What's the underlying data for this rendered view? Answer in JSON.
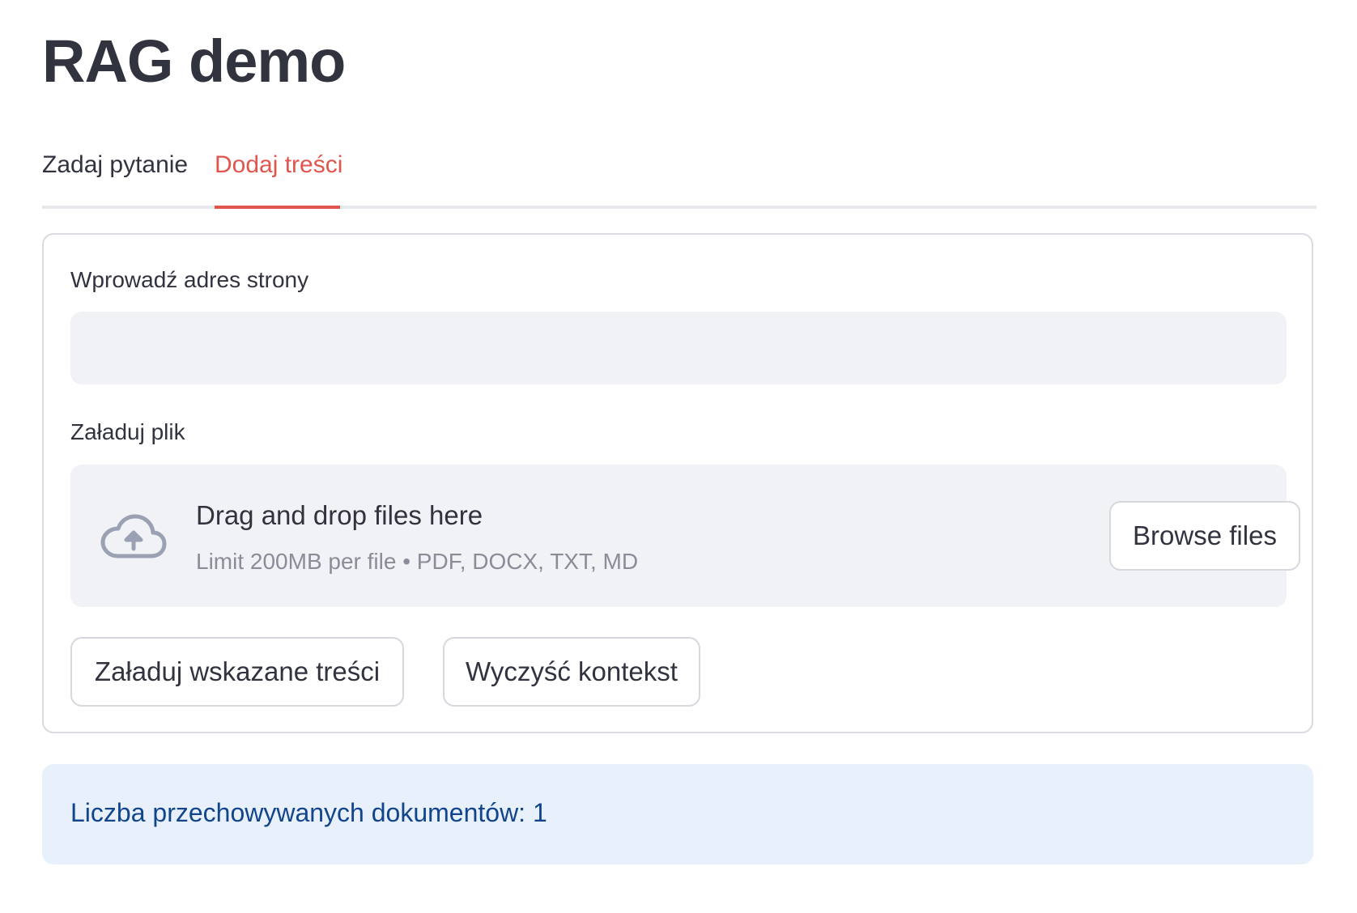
{
  "title": "RAG demo",
  "tabs": [
    {
      "label": "Zadaj pytanie",
      "active": false
    },
    {
      "label": "Dodaj treści",
      "active": true
    }
  ],
  "url_field": {
    "label": "Wprowadź adres strony",
    "value": "",
    "placeholder": ""
  },
  "file_upload": {
    "label": "Załaduj plik",
    "drop_text": "Drag and drop files here",
    "hint": "Limit 200MB per file • PDF, DOCX, TXT, MD",
    "browse_label": "Browse files",
    "icon": "cloud-upload-icon"
  },
  "actions": {
    "load_label": "Załaduj wskazane treści",
    "clear_label": "Wyczyść kontekst"
  },
  "info": {
    "text": "Liczba przechowywanych dokumentów: 1"
  },
  "colors": {
    "accent": "#e0564f",
    "text": "#31333f",
    "info_bg": "#e8f1fb",
    "info_text": "#12458c",
    "input_bg": "#f0f2f6"
  }
}
